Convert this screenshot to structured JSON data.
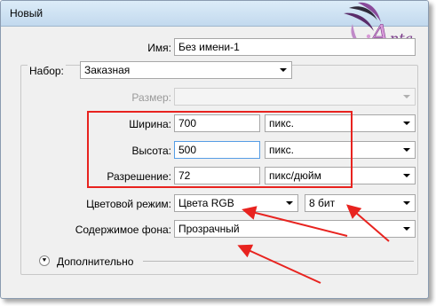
{
  "window": {
    "title": "Новый"
  },
  "form": {
    "name_label": "Имя:",
    "name_value": "Без имени-1",
    "preset_label": "Набор:",
    "preset_value": "Заказная",
    "size_label": "Размер:",
    "size_value": "",
    "width_label": "Ширина:",
    "width_value": "700",
    "width_unit": "пикс.",
    "height_label": "Высота:",
    "height_value": "500",
    "height_unit": "пикс.",
    "resolution_label": "Разрешение:",
    "resolution_value": "72",
    "resolution_unit": "пикс/дюйм",
    "color_mode_label": "Цветовой режим:",
    "color_mode_value": "Цвета RGB",
    "bit_depth_value": "8 бит",
    "background_label": "Содержимое фона:",
    "background_value": "Прозрачный",
    "advanced_label": "Дополнительно"
  },
  "watermark": {
    "text": "Anta"
  },
  "colors": {
    "annotation": "#e8231f",
    "titlebar": "#c2d9ee",
    "focus": "#569de5"
  }
}
